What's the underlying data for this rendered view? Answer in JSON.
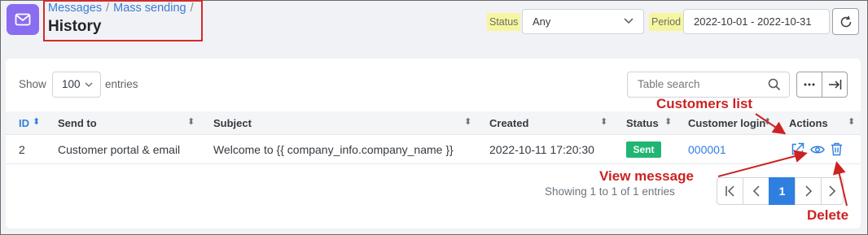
{
  "header": {
    "breadcrumb": [
      "Messages",
      "Mass sending"
    ],
    "breadcrumb_separator": "/",
    "title": "History",
    "status_label": "Status",
    "status_value": "Any",
    "period_label": "Period",
    "period_value": "2022-10-01 - 2022-10-31"
  },
  "toolbar": {
    "show_label": "Show",
    "entries_value": "100",
    "entries_label": "entries",
    "search_placeholder": "Table search"
  },
  "table": {
    "columns": [
      "ID",
      "Send to",
      "Subject",
      "Created",
      "Status",
      "Customer login",
      "Actions"
    ],
    "rows": [
      {
        "id": "2",
        "send_to": "Customer portal & email",
        "subject": "Welcome to {{ company_info.company_name }}",
        "created": "2022-10-11 17:20:30",
        "status": "Sent",
        "customer_login": "000001"
      }
    ]
  },
  "pagination": {
    "summary": "Showing 1 to 1 of 1 entries",
    "current_page": "1"
  },
  "annotations": {
    "customers_list": "Customers list",
    "view_message": "View message",
    "delete": "Delete"
  },
  "colors": {
    "accent": "#2f7fe0",
    "app_icon": "#8a6cf0",
    "status_sent": "#21b573",
    "annotation": "#cc2222",
    "filter_label_highlight": "#f6f6a0"
  },
  "icons": [
    "envelope-icon",
    "chevron-down-icon",
    "refresh-icon",
    "search-icon",
    "more-icon",
    "expand-icon",
    "sort-icon",
    "open-external-icon",
    "eye-icon",
    "trash-icon",
    "first-page-icon",
    "prev-page-icon",
    "next-page-icon"
  ]
}
